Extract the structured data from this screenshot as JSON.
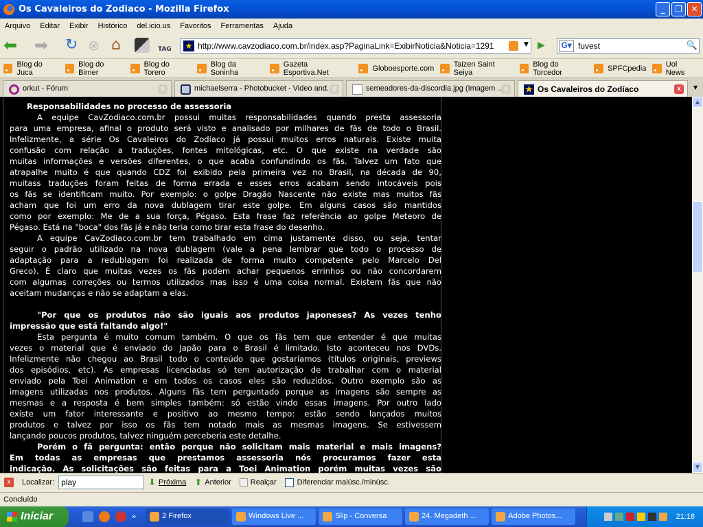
{
  "window": {
    "title": "Os Cavaleiros do Zodiaco - Mozilla Firefox"
  },
  "menu": [
    "Arquivo",
    "Editar",
    "Exibir",
    "Histórico",
    "del.icio.us",
    "Favoritos",
    "Ferramentas",
    "Ajuda"
  ],
  "nav": {
    "url": "http://www.cavzodiaco.com.br/index.asp?PaginaLink=ExibirNoticia&Noticia=1291",
    "search": "fuvest",
    "tag_label": "TAG"
  },
  "bookmarks": [
    "Blog do Juca",
    "Blog do Birner",
    "Blog do Torero",
    "Blog da Soninha",
    "Gazeta Esportiva.Net",
    "Globoesporte.com",
    "Taizen Saint Seiya",
    "Blog do Torcedor",
    "SPFCpedia",
    "Uol News"
  ],
  "tabs": [
    {
      "label": "orkut - Fórum"
    },
    {
      "label": "michaelserra - Photobucket - Video and..."
    },
    {
      "label": "semeadores-da-discordia.jpg (Imagem ..."
    },
    {
      "label": "Os Cavaleiros do Zodíaco"
    }
  ],
  "article": {
    "heading": "Responsabilidades no processo de assessoria",
    "lines": [
      {
        "t": "A equipe CavZodiaco.com.br possui muitas responsabilidades quando presta assessoria",
        "c": "ind"
      },
      {
        "t": "para uma empresa, afinal o produto será visto e analisado por milhares de fãs de todo o Brasil."
      },
      {
        "t": "Infelizmente, a série Os Cavaleiros do Zodíaco já possui muitos erros naturais. Existe muita"
      },
      {
        "t": "confusão com relação a traduções, fontes mitológicas, etc. O que existe na verdade são"
      },
      {
        "t": "muitas informações e versões diferentes, o que acaba confundindo os fãs. Talvez um fato que"
      },
      {
        "t": "atrapalhe muito é que quando CDZ foi exibido pela primeira vez no Brasil, na década de 90,"
      },
      {
        "t": "muitass traduções foram feitas de forma errada e esses erros acabam sendo intocáveis pois"
      },
      {
        "t": "os fãs se identificam muito. Por exemplo: o golpe Dragão Nascente não existe mas muitos fãs"
      },
      {
        "t": "acham que foi um erro da nova dublagem tirar este golpe. Em alguns casos são mantidos"
      },
      {
        "t": "como por exemplo: Me de a sua força, Pégaso. Esta frase faz referência ao golpe Meteoro de"
      },
      {
        "t": "Pégaso. Está na \"boca\" dos fãs já e não teria como tirar esta frase do desenho.",
        "c": "last"
      },
      {
        "t": "A equipe CavZodiaco.com.br tem trabalhado em cima justamente disso, ou seja, tentar",
        "c": "ind"
      },
      {
        "t": "seguir o padrão utilizado na nova dublagem (vale a pena lembrar que todo o processo de"
      },
      {
        "t": "adaptação para a redublagem foi realizada de forma muito competente pelo Marcelo Del"
      },
      {
        "t": "Greco). É claro que muitas vezes os fãs podem achar pequenos errinhos ou não concordarem"
      },
      {
        "t": "com algumas correções ou termos utilizados mas isso é uma coisa normal. Existem fãs que não"
      },
      {
        "t": "aceitam mudanças e não se adaptam a elas.",
        "c": "last"
      },
      {
        "t": "",
        "c": "last"
      },
      {
        "t": "\"Por que os produtos não são iguais aos produtos japoneses? As vezes tenho",
        "c": "ind b"
      },
      {
        "t": "impressão que está faltando algo!\"",
        "c": "last b"
      },
      {
        "t": "Esta pergunta é muito comum também. O que os fãs tem que entender é que muitas",
        "c": "ind"
      },
      {
        "t": "vezes o material que é enviado do Japão para o Brasil é limitado. Isto aconteceu nos DVDs."
      },
      {
        "t": "Infelizmente não chegou ao Brasil todo o conteúdo que gostaríamos (títulos originais, previews"
      },
      {
        "t": "dos episódios, etc). As empresas licenciadas só tem autorização de trabalhar com o material"
      },
      {
        "t": "enviado pela Toei Animation e em todos os casos eles são reduzidos. Outro exemplo são as"
      },
      {
        "t": "imagens utilizadas nos produtos. Alguns fãs tem perguntado porque as imagens são sempre as"
      },
      {
        "t": "mesmas e a resposta é bem simples também: só estão vindo essas imagens. Por outro lado"
      },
      {
        "t": "existe um fator interessante e positivo ao mesmo tempo: estão sendo lançados muitos"
      },
      {
        "t": "produtos e talvez por isso os fãs tem notado mais as mesmas imagens. Se estivessem"
      },
      {
        "t": "lançando poucos produtos, talvez ninguém perceberia este detalhe.",
        "c": "last"
      },
      {
        "t": "Porém o fã pergunta: então porque não solicitam mais material e mais imagens?",
        "c": "ind b"
      },
      {
        "t": "Em todas as empresas que prestamos assessoria nós procuramos fazer esta",
        "c": "b"
      },
      {
        "t": "indicação. As solicitações são feitas para a Toei Animation porém muitas vezes são",
        "c": "b"
      }
    ]
  },
  "findbar": {
    "label": "Localizar:",
    "value": "play",
    "next": "Próxima",
    "prev": "Anterior",
    "highlight": "Realçar",
    "match_case": "Diferenciar maiúsc./minúsc."
  },
  "status": "Concluído",
  "taskbar": {
    "start": "Iniciar",
    "tasks": [
      "2 Firefox",
      "Windows Live ...",
      "Slip - Conversa",
      "24. Megadeth ...",
      "Adobe Photos..."
    ],
    "clock": "21:18"
  }
}
